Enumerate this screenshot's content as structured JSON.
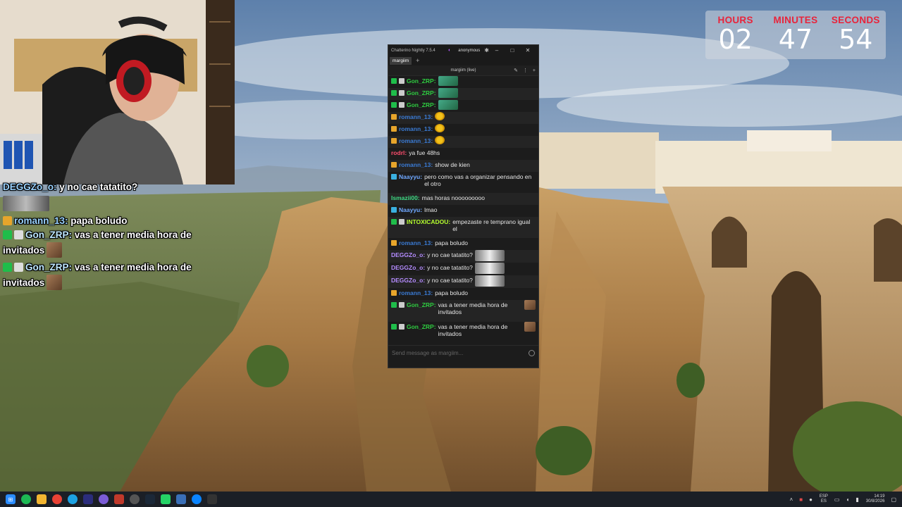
{
  "timer": {
    "hours_label": "HOURS",
    "hours": "02",
    "minutes_label": "MINUTES",
    "minutes": "47",
    "seconds_label": "SECONDS",
    "seconds": "54"
  },
  "overlay_chat": {
    "messages": [
      {
        "user": "DEGGZo_o:",
        "text": "y no cae tatatito?"
      },
      {
        "user": "romann_13:",
        "text": "papa boludo"
      },
      {
        "user": "Gon_ZRP:",
        "text": "vas a tener media hora de invitados"
      },
      {
        "user": "Gon_ZRP:",
        "text": "vas a tener media hora de invitados"
      }
    ]
  },
  "chat_window": {
    "app_title": "Chatterino Nightly 7.5.4",
    "account": "anonymous",
    "tab": "margiim",
    "tab_add": "+",
    "channel_header": "margiim (live)",
    "input_placeholder": "Send message as margiim...",
    "messages": [
      {
        "user": "Gon_ZRP:",
        "color": "#2ecc40",
        "text": "",
        "emote": "pepe-green"
      },
      {
        "user": "Gon_ZRP:",
        "color": "#2ecc40",
        "text": "",
        "emote": "pepe-green"
      },
      {
        "user": "Gon_ZRP:",
        "color": "#2ecc40",
        "text": "",
        "emote": "pepe-green"
      },
      {
        "user": "romann_13:",
        "color": "#3a7bd5",
        "text": "",
        "emote": "pepe-yellow"
      },
      {
        "user": "romann_13:",
        "color": "#3a7bd5",
        "text": "",
        "emote": "pepe-yellow"
      },
      {
        "user": "romann_13:",
        "color": "#3a7bd5",
        "text": "",
        "emote": "pepe-yellow"
      },
      {
        "user": "rodrl:",
        "color": "#ff4d6d",
        "text": "ya fue 48hs"
      },
      {
        "user": "romann_13:",
        "color": "#3a7bd5",
        "text": "show de kien"
      },
      {
        "user": "Naayyu:",
        "color": "#6fa8ff",
        "text": "pero como vas a organizar pensando en el otro"
      },
      {
        "user": "Ismazii00:",
        "color": "#3ddc84",
        "text": "mas horas nooooooooo"
      },
      {
        "user": "Naayyu:",
        "color": "#6fa8ff",
        "text": "lmao"
      },
      {
        "user": "INTOXICADOU:",
        "color": "#b6ff2e",
        "text": "empezaste re temprano igual el"
      },
      {
        "user": "romann_13:",
        "color": "#3a7bd5",
        "text": "papa boludo"
      },
      {
        "user": "DEGGZo_o:",
        "color": "#b58cff",
        "text": "y no cae tatatito?"
      },
      {
        "user": "DEGGZo_o:",
        "color": "#b58cff",
        "text": "y no cae tatatito?"
      },
      {
        "user": "DEGGZo_o:",
        "color": "#b58cff",
        "text": "y no cae tatatito?"
      },
      {
        "user": "romann_13:",
        "color": "#3a7bd5",
        "text": "papa boludo"
      },
      {
        "user": "Gon_ZRP:",
        "color": "#2ecc40",
        "text": "vas a tener media hora de invitados"
      },
      {
        "user": "Gon_ZRP:",
        "color": "#2ecc40",
        "text": "vas a tener media hora de invitados"
      }
    ]
  },
  "taskbar": {
    "lang_top": "ESP",
    "lang_bottom": "ES",
    "time": "14:19",
    "date": "30/8/2026"
  },
  "colors": {
    "timer_label": "#e8243b",
    "chat_bg": "#1c1c1c",
    "taskbar_bg": "#1b1f26"
  }
}
